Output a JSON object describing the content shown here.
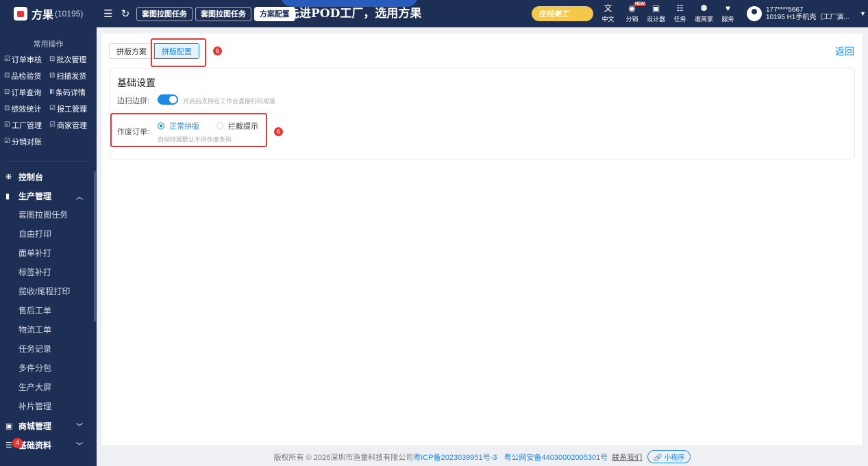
{
  "brand": {
    "name": "方果",
    "code": "(10195)"
  },
  "header": {
    "tabs": [
      {
        "label": "套图拉图任务"
      },
      {
        "label": "套图拉图任务"
      },
      {
        "label": "方案配置"
      }
    ],
    "banner": "先进POD工厂，选用方果",
    "online_badge": "在线美工",
    "tools": [
      {
        "icon": "文",
        "label": "中文"
      },
      {
        "icon": "◉",
        "label": "分销",
        "badge": "NEW"
      },
      {
        "icon": "▣",
        "label": "设计器"
      },
      {
        "icon": "☷",
        "label": "任务"
      },
      {
        "icon": "⚉",
        "label": "邀商家"
      },
      {
        "icon": "♥",
        "label": "服务"
      }
    ],
    "user": {
      "phone": "177****5667",
      "desc": "10195 H1手机壳（工厂演..."
    }
  },
  "sidebar": {
    "common_title": "常用操作",
    "quick_ops": [
      {
        "icon": "☑",
        "label": "订单审核"
      },
      {
        "icon": "⊡",
        "label": "批次管理"
      },
      {
        "icon": "⊡",
        "label": "品检验货"
      },
      {
        "icon": "⊟",
        "label": "扫描发货"
      },
      {
        "icon": "⊡",
        "label": "订单查询"
      },
      {
        "icon": "Ⅲ",
        "label": "条码详情"
      },
      {
        "icon": "⊡",
        "label": "绩效统计"
      },
      {
        "icon": "☑",
        "label": "报工管理"
      },
      {
        "icon": "☑",
        "label": "工厂管理"
      },
      {
        "icon": "☑",
        "label": "商家管理"
      },
      {
        "icon": "☑",
        "label": "分销对账"
      }
    ],
    "groups": {
      "dashboard": "控制台",
      "production": "生产管理",
      "mall": "商城管理",
      "basic": "基础资料"
    },
    "production_items": [
      "套图拉图任务",
      "自由打印",
      "面单补打",
      "标签补打",
      "揽收/尾程打印",
      "售后工单",
      "物流工单",
      "任务记录",
      "多件分包",
      "生产大屏",
      "补片管理"
    ],
    "notification_count": "4"
  },
  "main": {
    "segments": [
      {
        "label": "拼版方案",
        "active": false
      },
      {
        "label": "拼版配置",
        "active": true
      }
    ],
    "step5": "5",
    "step6": "6",
    "back": "返回",
    "card": {
      "title": "基础设置",
      "edge_scan_label": "边扫边拼:",
      "edge_scan_on": true,
      "edge_scan_hint": "开启后支持在工作台直接扫码成版",
      "void_order_label": "作废订单:",
      "options": [
        {
          "label": "正常拼版",
          "checked": true
        },
        {
          "label": "拦截提示",
          "checked": false
        }
      ],
      "void_hint": "自动拼版默认不拼作废条码"
    }
  },
  "footer": {
    "copyright": "版权所有 © 2026深圳市渔童科技有限公司",
    "icp": "粤ICP备2023039951号-3",
    "police": "粤公网安备44030002005301号",
    "contact": "联系我们",
    "mini_program": "小程序"
  },
  "colors": {
    "sidebar_bg": "#1d2f55",
    "accent": "#1e88e5",
    "highlight": "#e53935"
  }
}
